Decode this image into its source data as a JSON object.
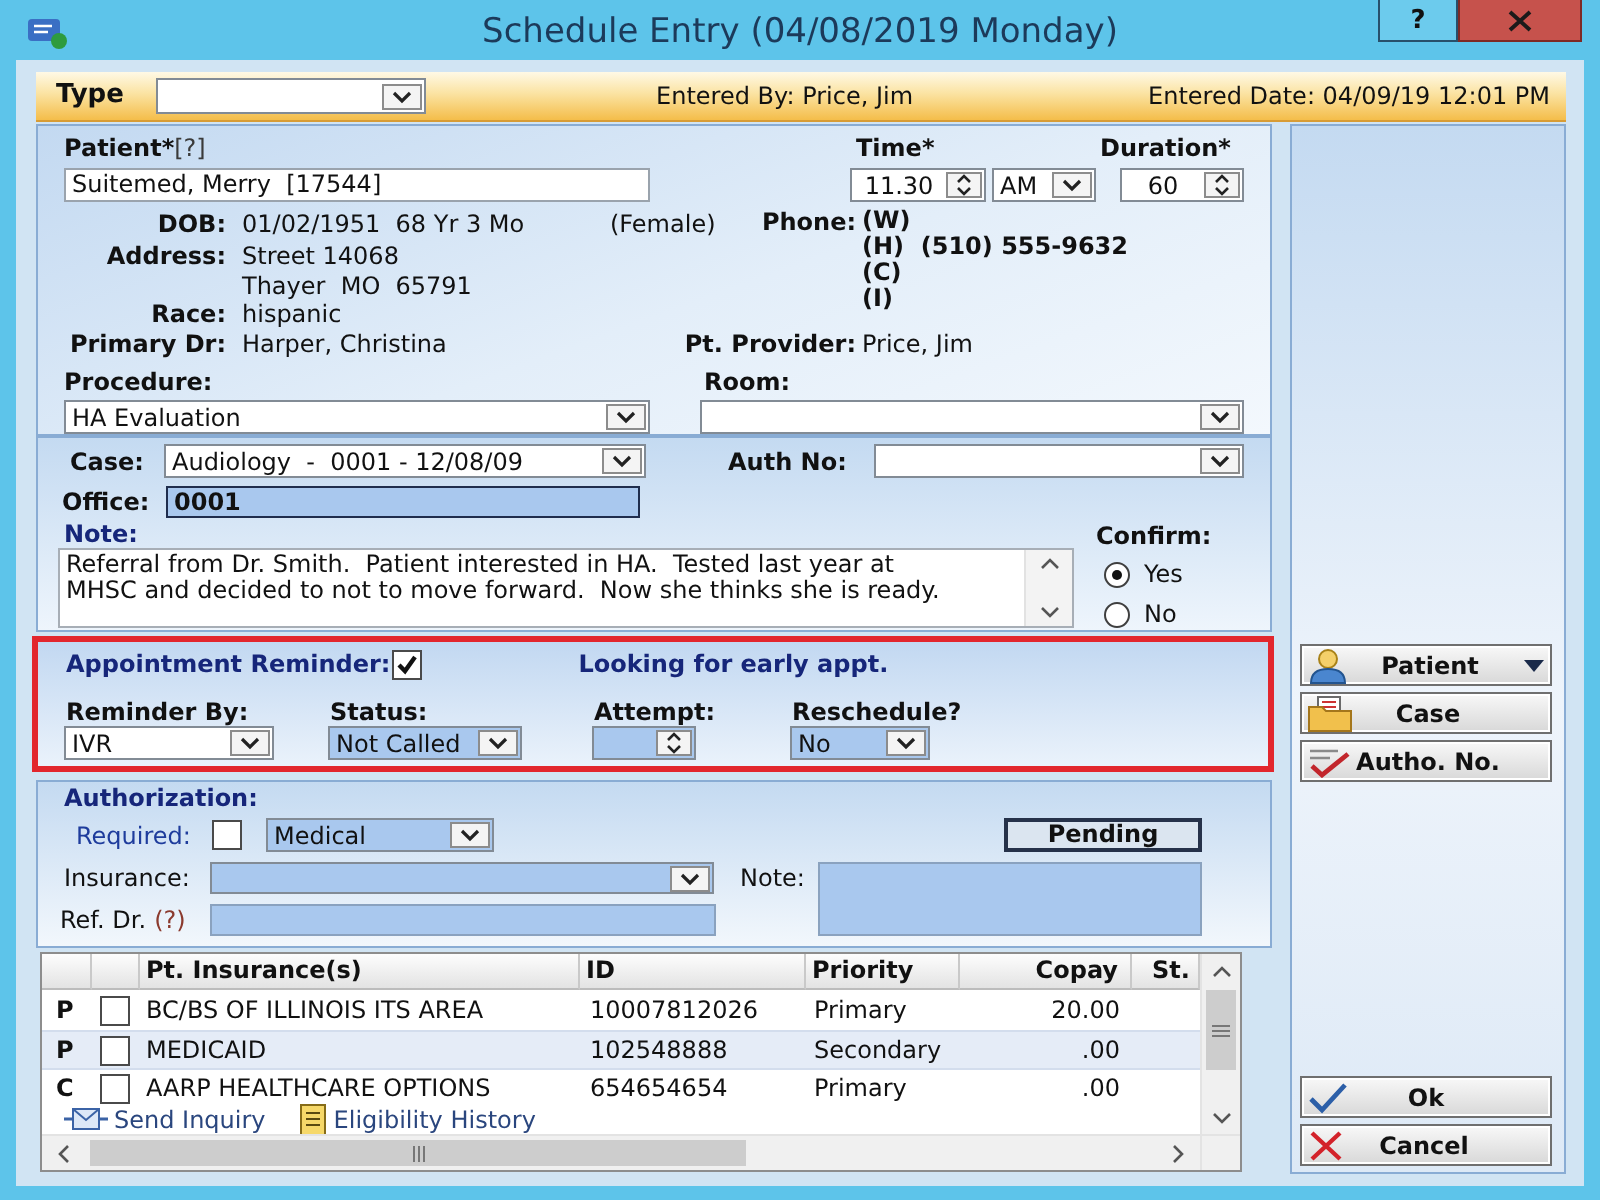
{
  "window": {
    "title": "Schedule Entry (04/08/2019 Monday)",
    "help_button": "?"
  },
  "header": {
    "type_label": "Type",
    "entered_by": "Entered By: Price, Jim",
    "entered_date": "Entered Date: 04/09/19 12:01 PM"
  },
  "patient": {
    "label": "Patient*",
    "help": "[?]",
    "value": "Suitemed, Merry  [17544]",
    "dob_label": "DOB:",
    "dob": "01/02/1951  68 Yr 3 Mo",
    "sex": "(Female)",
    "address_label": "Address:",
    "address": [
      "Street 14068",
      "Thayer  MO  65791"
    ],
    "race_label": "Race:",
    "race": "hispanic",
    "primary_dr_label": "Primary Dr:",
    "primary_dr": "Harper, Christina",
    "phone_label": "Phone:",
    "phones": [
      "(W)",
      "(H)  (510) 555-9632",
      "(C)",
      "(I)"
    ],
    "provider_label": "Pt. Provider:",
    "provider": "Price, Jim"
  },
  "time": {
    "label": "Time*",
    "value": "11.30",
    "meridiem": "AM"
  },
  "duration": {
    "label": "Duration*",
    "value": "60"
  },
  "procedure": {
    "label": "Procedure:",
    "value": "HA Evaluation"
  },
  "room": {
    "label": "Room:"
  },
  "case": {
    "label": "Case:",
    "value": "Audiology  -  0001 - 12/08/09"
  },
  "auth_no": {
    "label": "Auth No:"
  },
  "office": {
    "label": "Office:",
    "value": "0001"
  },
  "note": {
    "label": "Note:",
    "value": "Referral from Dr. Smith.  Patient interested in HA.  Tested last year at MHSC and decided to not to move forward.  Now she thinks she is ready."
  },
  "confirm": {
    "label": "Confirm:",
    "options": [
      {
        "label": "Yes",
        "selected": true
      },
      {
        "label": "No",
        "selected": false
      }
    ]
  },
  "reminder": {
    "highlighted": true,
    "label": "Appointment Reminder:",
    "checked": true,
    "remark": "Looking for early appt.",
    "fields": [
      {
        "label": "Reminder By:",
        "kind": "dropdown",
        "value": "IVR",
        "readonly": false
      },
      {
        "label": "Status:",
        "kind": "dropdown",
        "value": "Not Called",
        "readonly": true
      },
      {
        "label": "Attempt:",
        "kind": "spinner",
        "readonly": true
      },
      {
        "label": "Reschedule?",
        "kind": "dropdown",
        "value": "No",
        "readonly": true
      }
    ]
  },
  "authorization": {
    "title": "Authorization:",
    "required_label": "Required:",
    "required": false,
    "type": "Medical",
    "status": "Pending",
    "insurance_label": "Insurance:",
    "note_label": "Note:",
    "ref_dr_label": "Ref. Dr.",
    "ref_dr_help": "(?)"
  },
  "insurance_table": {
    "columns": [
      "Pt. Insurance(s)",
      "ID",
      "Priority",
      "Copay",
      "St."
    ],
    "rows": [
      {
        "column_1": "P",
        "checked": false,
        "name": "BC/BS OF ILLINOIS ITS AREA",
        "id": "10007812026",
        "priority": "Primary",
        "copay": "20.00",
        "selected": false
      },
      {
        "column_1": "P",
        "checked": false,
        "name": "MEDICAID",
        "id": "102548888",
        "priority": "Secondary",
        "copay": ".00",
        "selected": true
      },
      {
        "column_1": "C",
        "checked": false,
        "name": "AARP HEALTHCARE OPTIONS",
        "id": "654654654",
        "priority": "Primary",
        "copay": ".00",
        "selected": false
      }
    ],
    "links": [
      "Send Inquiry",
      "Eligibility History"
    ]
  },
  "side_buttons": [
    {
      "label": "Patient",
      "kind": "menu"
    },
    {
      "label": "Case",
      "kind": "plain"
    },
    {
      "label": "Autho. No.",
      "kind": "plain"
    }
  ],
  "dialog_buttons": [
    "Ok",
    "Cancel"
  ]
}
